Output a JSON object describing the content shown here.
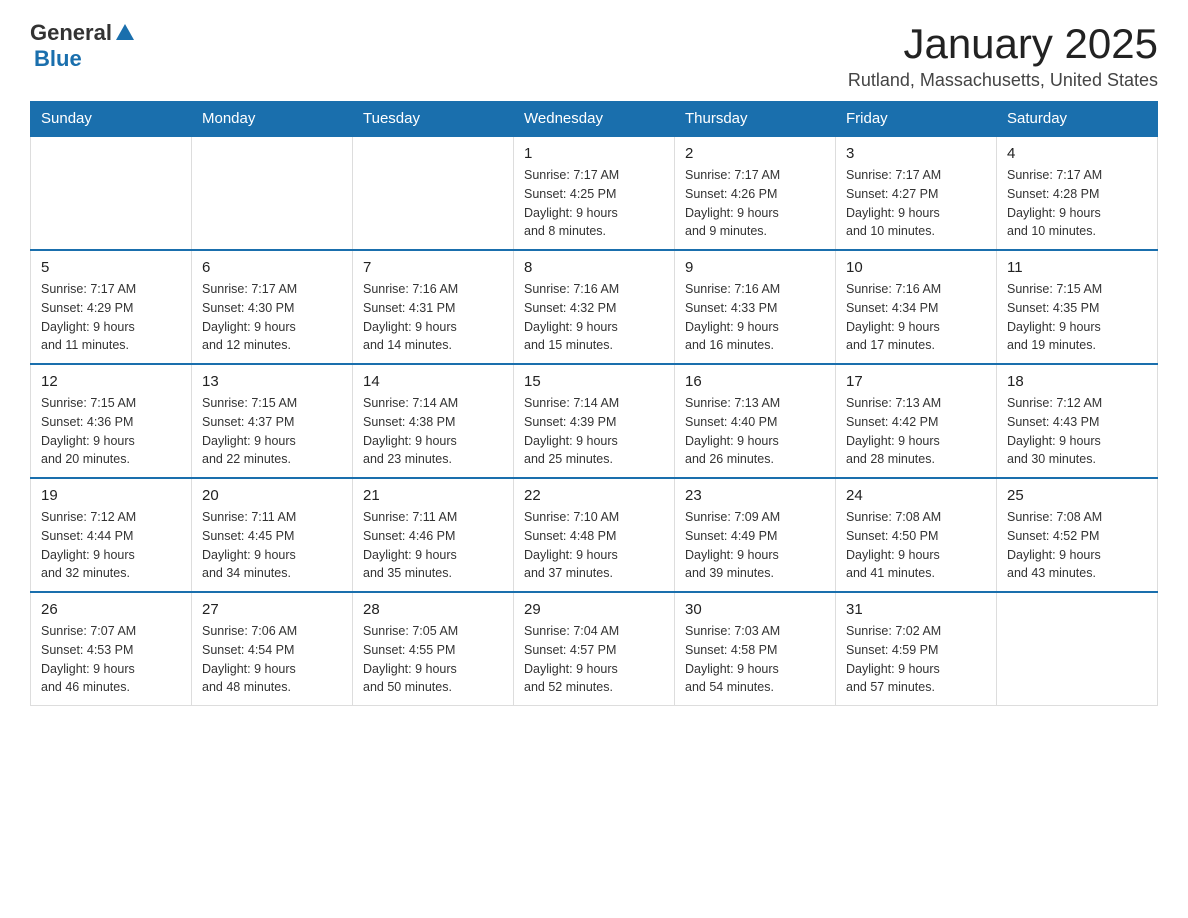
{
  "logo": {
    "general": "General",
    "blue": "Blue"
  },
  "header": {
    "title": "January 2025",
    "subtitle": "Rutland, Massachusetts, United States"
  },
  "weekdays": [
    "Sunday",
    "Monday",
    "Tuesday",
    "Wednesday",
    "Thursday",
    "Friday",
    "Saturday"
  ],
  "weeks": [
    [
      {
        "day": "",
        "info": ""
      },
      {
        "day": "",
        "info": ""
      },
      {
        "day": "",
        "info": ""
      },
      {
        "day": "1",
        "info": "Sunrise: 7:17 AM\nSunset: 4:25 PM\nDaylight: 9 hours\nand 8 minutes."
      },
      {
        "day": "2",
        "info": "Sunrise: 7:17 AM\nSunset: 4:26 PM\nDaylight: 9 hours\nand 9 minutes."
      },
      {
        "day": "3",
        "info": "Sunrise: 7:17 AM\nSunset: 4:27 PM\nDaylight: 9 hours\nand 10 minutes."
      },
      {
        "day": "4",
        "info": "Sunrise: 7:17 AM\nSunset: 4:28 PM\nDaylight: 9 hours\nand 10 minutes."
      }
    ],
    [
      {
        "day": "5",
        "info": "Sunrise: 7:17 AM\nSunset: 4:29 PM\nDaylight: 9 hours\nand 11 minutes."
      },
      {
        "day": "6",
        "info": "Sunrise: 7:17 AM\nSunset: 4:30 PM\nDaylight: 9 hours\nand 12 minutes."
      },
      {
        "day": "7",
        "info": "Sunrise: 7:16 AM\nSunset: 4:31 PM\nDaylight: 9 hours\nand 14 minutes."
      },
      {
        "day": "8",
        "info": "Sunrise: 7:16 AM\nSunset: 4:32 PM\nDaylight: 9 hours\nand 15 minutes."
      },
      {
        "day": "9",
        "info": "Sunrise: 7:16 AM\nSunset: 4:33 PM\nDaylight: 9 hours\nand 16 minutes."
      },
      {
        "day": "10",
        "info": "Sunrise: 7:16 AM\nSunset: 4:34 PM\nDaylight: 9 hours\nand 17 minutes."
      },
      {
        "day": "11",
        "info": "Sunrise: 7:15 AM\nSunset: 4:35 PM\nDaylight: 9 hours\nand 19 minutes."
      }
    ],
    [
      {
        "day": "12",
        "info": "Sunrise: 7:15 AM\nSunset: 4:36 PM\nDaylight: 9 hours\nand 20 minutes."
      },
      {
        "day": "13",
        "info": "Sunrise: 7:15 AM\nSunset: 4:37 PM\nDaylight: 9 hours\nand 22 minutes."
      },
      {
        "day": "14",
        "info": "Sunrise: 7:14 AM\nSunset: 4:38 PM\nDaylight: 9 hours\nand 23 minutes."
      },
      {
        "day": "15",
        "info": "Sunrise: 7:14 AM\nSunset: 4:39 PM\nDaylight: 9 hours\nand 25 minutes."
      },
      {
        "day": "16",
        "info": "Sunrise: 7:13 AM\nSunset: 4:40 PM\nDaylight: 9 hours\nand 26 minutes."
      },
      {
        "day": "17",
        "info": "Sunrise: 7:13 AM\nSunset: 4:42 PM\nDaylight: 9 hours\nand 28 minutes."
      },
      {
        "day": "18",
        "info": "Sunrise: 7:12 AM\nSunset: 4:43 PM\nDaylight: 9 hours\nand 30 minutes."
      }
    ],
    [
      {
        "day": "19",
        "info": "Sunrise: 7:12 AM\nSunset: 4:44 PM\nDaylight: 9 hours\nand 32 minutes."
      },
      {
        "day": "20",
        "info": "Sunrise: 7:11 AM\nSunset: 4:45 PM\nDaylight: 9 hours\nand 34 minutes."
      },
      {
        "day": "21",
        "info": "Sunrise: 7:11 AM\nSunset: 4:46 PM\nDaylight: 9 hours\nand 35 minutes."
      },
      {
        "day": "22",
        "info": "Sunrise: 7:10 AM\nSunset: 4:48 PM\nDaylight: 9 hours\nand 37 minutes."
      },
      {
        "day": "23",
        "info": "Sunrise: 7:09 AM\nSunset: 4:49 PM\nDaylight: 9 hours\nand 39 minutes."
      },
      {
        "day": "24",
        "info": "Sunrise: 7:08 AM\nSunset: 4:50 PM\nDaylight: 9 hours\nand 41 minutes."
      },
      {
        "day": "25",
        "info": "Sunrise: 7:08 AM\nSunset: 4:52 PM\nDaylight: 9 hours\nand 43 minutes."
      }
    ],
    [
      {
        "day": "26",
        "info": "Sunrise: 7:07 AM\nSunset: 4:53 PM\nDaylight: 9 hours\nand 46 minutes."
      },
      {
        "day": "27",
        "info": "Sunrise: 7:06 AM\nSunset: 4:54 PM\nDaylight: 9 hours\nand 48 minutes."
      },
      {
        "day": "28",
        "info": "Sunrise: 7:05 AM\nSunset: 4:55 PM\nDaylight: 9 hours\nand 50 minutes."
      },
      {
        "day": "29",
        "info": "Sunrise: 7:04 AM\nSunset: 4:57 PM\nDaylight: 9 hours\nand 52 minutes."
      },
      {
        "day": "30",
        "info": "Sunrise: 7:03 AM\nSunset: 4:58 PM\nDaylight: 9 hours\nand 54 minutes."
      },
      {
        "day": "31",
        "info": "Sunrise: 7:02 AM\nSunset: 4:59 PM\nDaylight: 9 hours\nand 57 minutes."
      },
      {
        "day": "",
        "info": ""
      }
    ]
  ]
}
